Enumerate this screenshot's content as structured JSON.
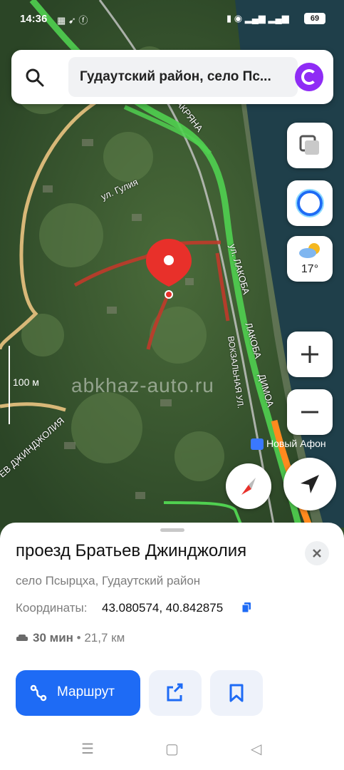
{
  "status": {
    "time": "14:36",
    "battery": "69"
  },
  "search": {
    "text": "Гудаутский район, село Пс..."
  },
  "weather": {
    "temp": "17°"
  },
  "map": {
    "streets": [
      "АКРЯНА",
      "ул. Гулия",
      "ул. ЛАКОБА",
      "ЛАКОБА",
      "ДИМОА",
      "ВОКЗАЛЬНАЯ УЛ.",
      "ЕВ ДЖИНДЖОЛИЯ"
    ],
    "scale": "100 м",
    "watermark": "abkhaz-auto.ru",
    "poi": "Новый Афон"
  },
  "place": {
    "title": "проезд Братьев Джинджолия",
    "subtitle": "село Псырцха, Гудаутский район",
    "coords_label": "Координаты:",
    "coords_value": "43.080574, 40.842875",
    "duration": "30 мин",
    "distance": "• 21,7 км",
    "route_label": "Маршрут"
  },
  "colors": {
    "accent": "#1e6bf5",
    "pin": "#e8302a",
    "alice": "#8f2cf5"
  },
  "icons": [
    "search-icon",
    "alice-icon",
    "layers-icon",
    "alice-ring-icon",
    "weather-icon",
    "zoom-in-icon",
    "zoom-out-icon",
    "compass-icon",
    "locate-icon",
    "close-icon",
    "copy-icon",
    "car-icon",
    "route-icon",
    "share-icon",
    "bookmark-icon"
  ]
}
